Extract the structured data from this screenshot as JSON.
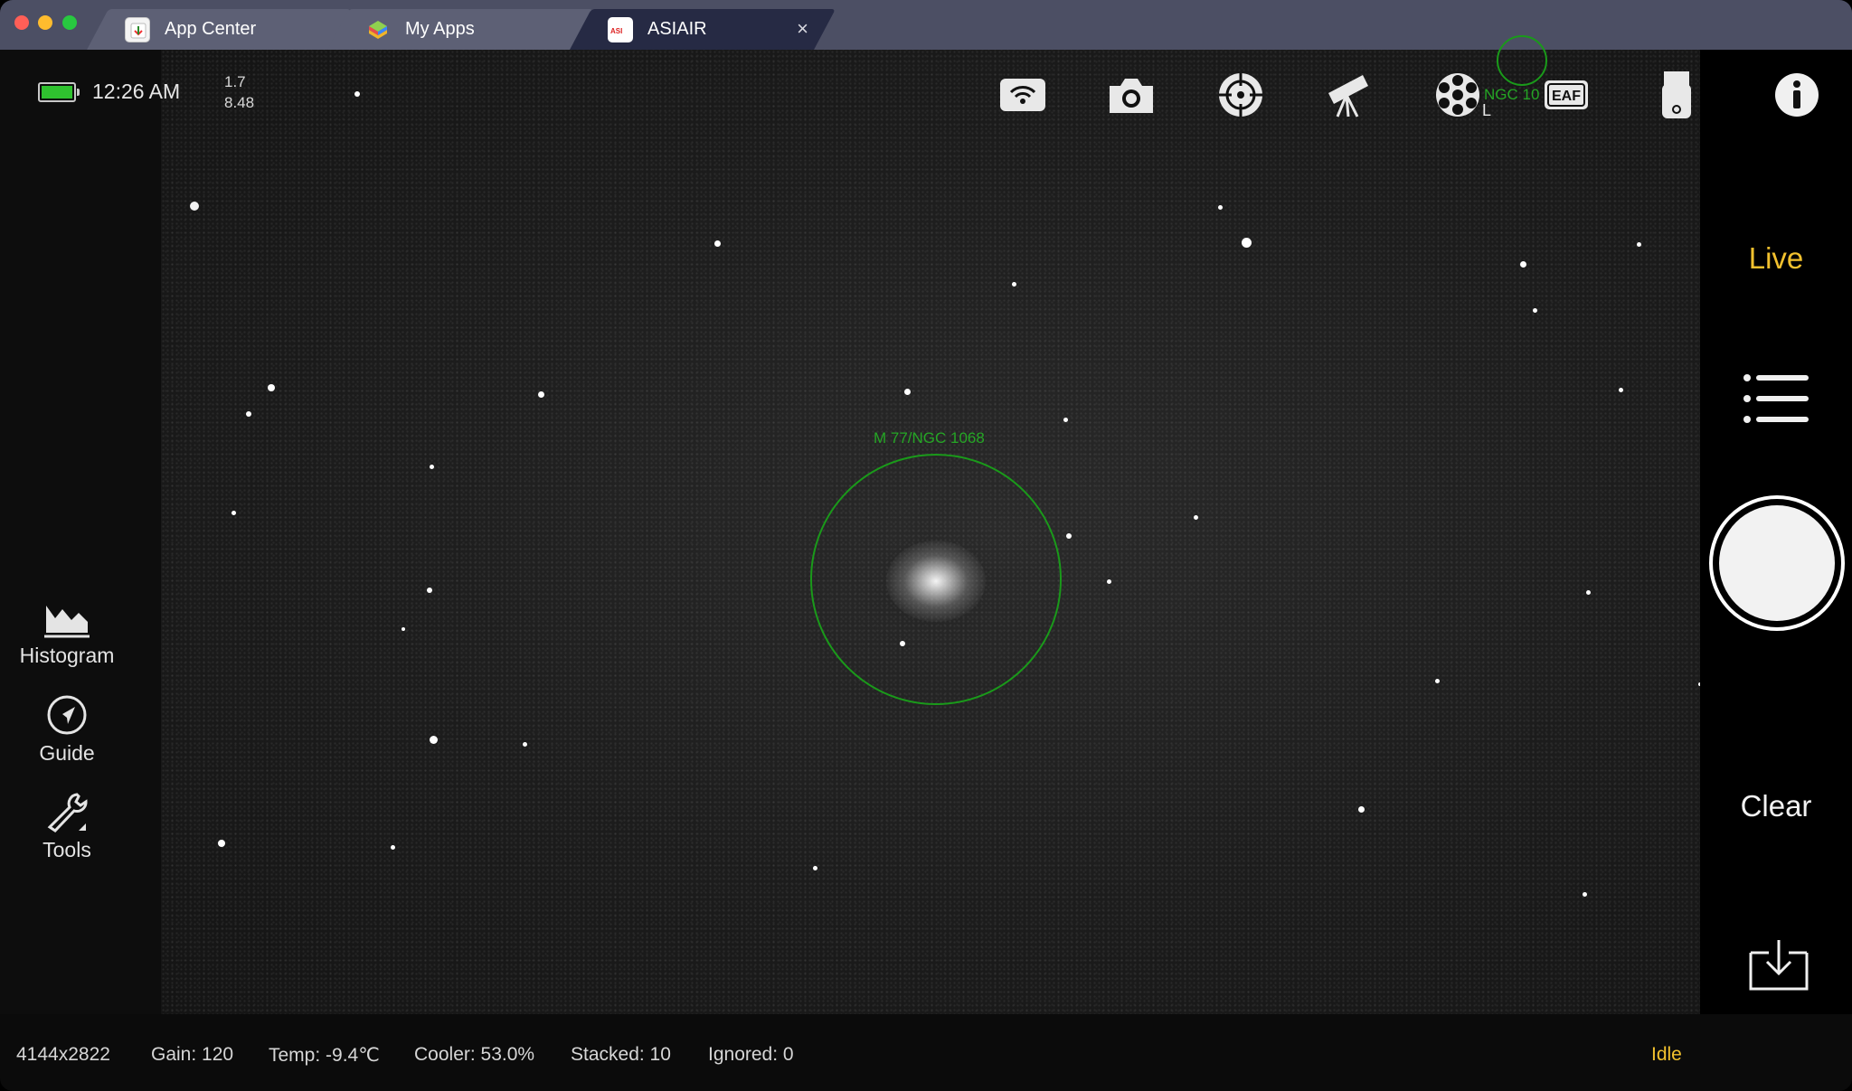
{
  "tabs": [
    {
      "label": "App Center"
    },
    {
      "label": "My Apps"
    },
    {
      "label": "ASIAIR",
      "close_glyph": "×"
    }
  ],
  "status": {
    "time": "12:26 AM",
    "value_1": "1.7",
    "value_2": "8.48",
    "battery_color": "#2fc22f"
  },
  "top_icons": [
    "wifi-icon",
    "camera-icon",
    "guide-scope-icon",
    "telescope-icon",
    "filter-wheel-icon",
    "eaf-icon",
    "usb-drive-icon",
    "info-icon"
  ],
  "eaf_label": "EAF",
  "sky": {
    "target_label": "M 77/NGC 1068",
    "mini_target_label": "NGC 10",
    "mini_letter": "L",
    "annotation_color": "#1a9a1a"
  },
  "left_tools": [
    {
      "label": "Histogram",
      "icon": "histogram-icon"
    },
    {
      "label": "Guide",
      "icon": "compass-icon"
    },
    {
      "label": "Tools",
      "icon": "wrench-icon"
    }
  ],
  "right": {
    "mode": "Live",
    "clear": "Clear",
    "accent_color": "#f2c12e"
  },
  "bottom": {
    "resolution": "4144x2822",
    "gain": "Gain: 120",
    "temp": "Temp: -9.4℃",
    "cooler": "Cooler: 53.0%",
    "stacked": "Stacked: 10",
    "ignored": "Ignored: 0",
    "state": "Idle"
  }
}
